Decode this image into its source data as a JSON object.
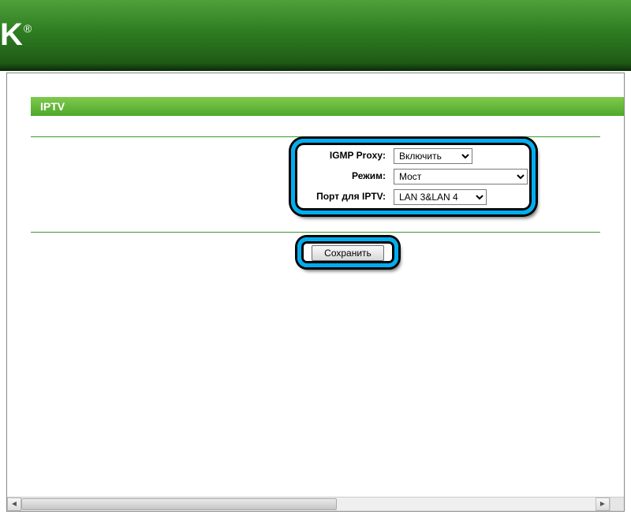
{
  "brand": {
    "logo_text": "K",
    "registered": "®"
  },
  "page": {
    "title": "IPTV"
  },
  "form": {
    "igmp_proxy": {
      "label": "IGMP Proxy:",
      "value": "Включить"
    },
    "mode": {
      "label": "Режим:",
      "value": "Мост"
    },
    "iptv_port": {
      "label": "Порт для IPTV:",
      "value": "LAN 3&LAN 4"
    }
  },
  "actions": {
    "save": "Сохранить"
  },
  "scroll": {
    "left": "◄",
    "right": "►"
  }
}
